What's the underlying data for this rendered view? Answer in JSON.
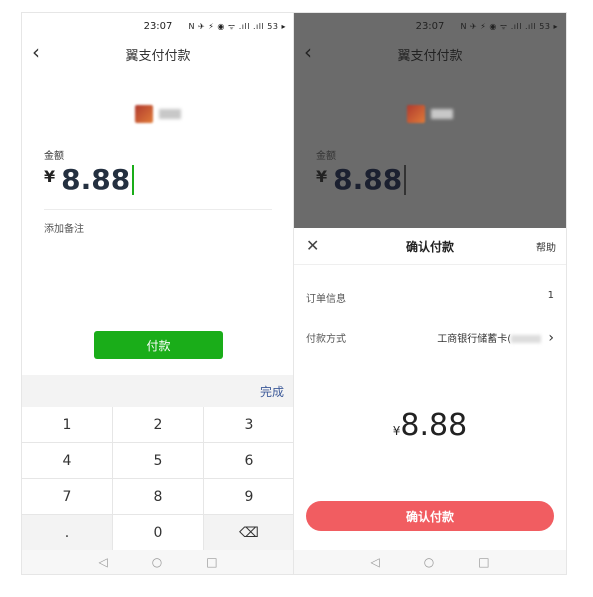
{
  "left": {
    "status": {
      "time": "23:07",
      "icons": "N ✈ ⚡ ◉ ᯤ .ıll .ıll 53 ▸"
    },
    "title": "翼支付付款",
    "back_glyph": "‹",
    "amount_label": "金额",
    "currency": "¥",
    "amount": "8.88",
    "note_link": "添加备注",
    "pay_button": "付款",
    "keyboard_done": "完成",
    "keys": [
      "1",
      "2",
      "3",
      "4",
      "5",
      "6",
      "7",
      "8",
      "9",
      ".",
      "0",
      "⌫"
    ],
    "nav": [
      "◁",
      "○",
      "□"
    ]
  },
  "right": {
    "status": {
      "time": "23:07",
      "icons": "N ✈ ⚡ ◉ ᯤ .ıll .ıll 53 ▸"
    },
    "title": "翼支付付款",
    "back_glyph": "‹",
    "amount_label": "金额",
    "currency": "¥",
    "amount": "8.88",
    "sheet": {
      "close_glyph": "✕",
      "title": "确认付款",
      "help": "帮助",
      "order_label": "订单信息",
      "order_value": "1",
      "method_label": "付款方式",
      "method_value": "工商银行储蓄卡(",
      "chevron": "›",
      "currency": "¥",
      "amount": "8.88",
      "confirm_button": "确认付款"
    },
    "nav": [
      "◁",
      "○",
      "□"
    ]
  },
  "colors": {
    "green": "#1aad19",
    "red_button": "#f15d61",
    "done_blue": "#3d5a99"
  }
}
